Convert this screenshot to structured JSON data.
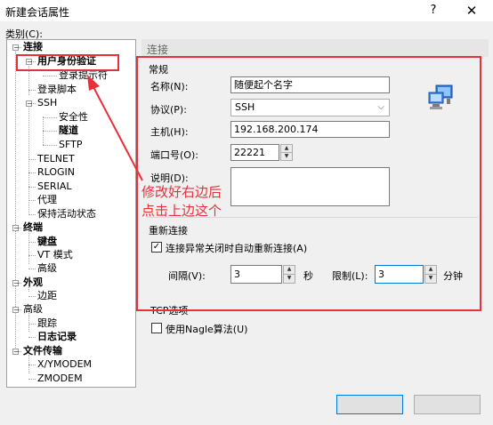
{
  "window": {
    "title": "新建会话属性",
    "help": "?",
    "close": "✕"
  },
  "category_label": "类别(C):",
  "tree": [
    {
      "label": "连接",
      "bold": true
    },
    {
      "label": "用户身份验证",
      "bold": true
    },
    {
      "label": "登录提示符"
    },
    {
      "label": "登录脚本"
    },
    {
      "label": "SSH"
    },
    {
      "label": "安全性"
    },
    {
      "label": "隧道",
      "bold": true
    },
    {
      "label": "SFTP"
    },
    {
      "label": "TELNET"
    },
    {
      "label": "RLOGIN"
    },
    {
      "label": "SERIAL"
    },
    {
      "label": "代理"
    },
    {
      "label": "保持活动状态"
    },
    {
      "label": "终端",
      "bold": true
    },
    {
      "label": "键盘",
      "bold": true
    },
    {
      "label": "VT 模式"
    },
    {
      "label": "高级"
    },
    {
      "label": "外观",
      "bold": true
    },
    {
      "label": "边距"
    },
    {
      "label": "高级"
    },
    {
      "label": "跟踪"
    },
    {
      "label": "日志记录",
      "bold": true
    },
    {
      "label": "文件传输",
      "bold": true
    },
    {
      "label": "X/YMODEM"
    },
    {
      "label": "ZMODEM"
    }
  ],
  "section_title": "连接",
  "general": {
    "title": "常规",
    "name_label": "名称(N):",
    "name_value": "随便起个名字",
    "protocol_label": "协议(P):",
    "protocol_value": "SSH",
    "host_label": "主机(H):",
    "host_value": "192.168.200.174",
    "port_label": "端口号(O):",
    "port_value": "22221",
    "desc_label": "说明(D):",
    "desc_value": ""
  },
  "reconnect": {
    "title": "重新连接",
    "auto_label": "连接异常关闭时自动重新连接(A)",
    "interval_label": "间隔(V):",
    "interval_value": "3",
    "seconds": "秒",
    "limit_label": "限制(L):",
    "limit_value": "3",
    "minutes": "分钟"
  },
  "tcp": {
    "title": "TCP选项",
    "nagle_label": "使用Nagle算法(U)"
  },
  "annotation": {
    "line1": "修改好右边后",
    "line2": "点击上边这个"
  },
  "colors": {
    "annotation_red": "#e8303b",
    "accent": "#0078d7"
  }
}
